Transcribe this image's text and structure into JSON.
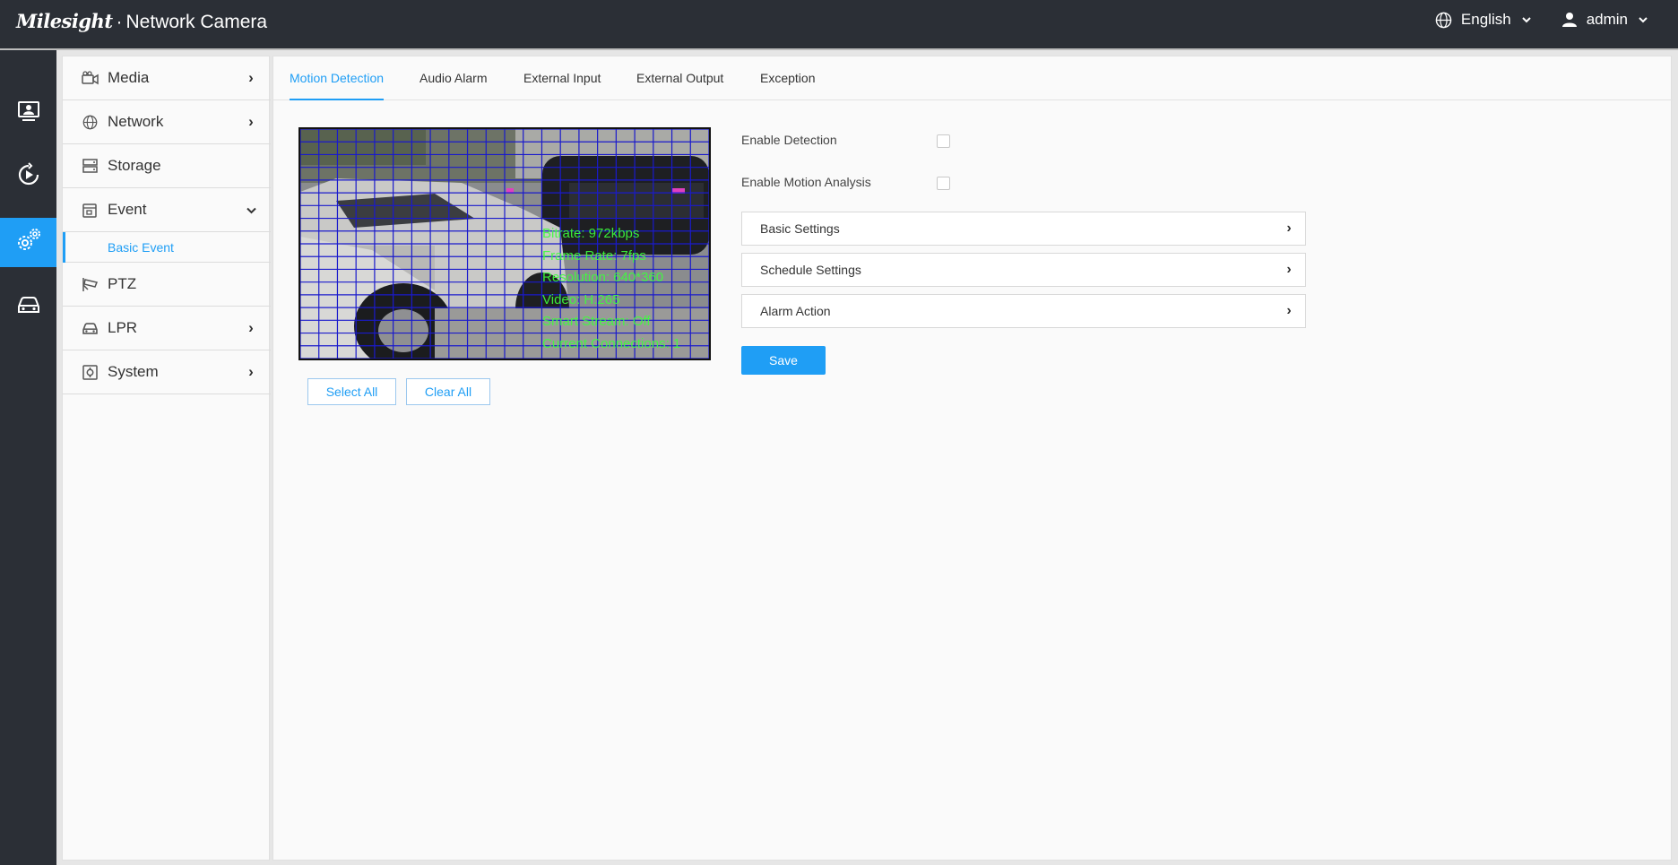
{
  "header": {
    "brand_logo": "Milesight",
    "brand_separator": "·",
    "brand_product": "Network Camera",
    "language": {
      "label": "English",
      "icon": "globe-icon"
    },
    "user": {
      "label": "admin",
      "icon": "user-icon"
    },
    "colors": {
      "bar": "#2b2f36",
      "accent": "#1f9ef5"
    }
  },
  "rail": {
    "items": [
      {
        "name": "live-view",
        "icon": "monitor-user-icon"
      },
      {
        "name": "playback",
        "icon": "play-circle-icon"
      },
      {
        "name": "settings",
        "icon": "gears-icon",
        "active": true
      },
      {
        "name": "vehicle",
        "icon": "car-icon"
      }
    ]
  },
  "subnav": {
    "items": [
      {
        "label": "Media",
        "icon": "camera-icon",
        "chevron": "›"
      },
      {
        "label": "Network",
        "icon": "globe-icon",
        "chevron": "›"
      },
      {
        "label": "Storage",
        "icon": "storage-icon",
        "chevron": ""
      },
      {
        "label": "Event",
        "icon": "event-icon",
        "chevron": "⌄"
      },
      {
        "label": "PTZ",
        "icon": "ptz-camera-icon",
        "chevron": ""
      },
      {
        "label": "LPR",
        "icon": "car-icon",
        "chevron": "›"
      },
      {
        "label": "System",
        "icon": "system-icon",
        "chevron": "›"
      }
    ],
    "active_sub": "Basic Event"
  },
  "tabs": [
    {
      "label": "Motion Detection",
      "active": true
    },
    {
      "label": "Audio Alarm"
    },
    {
      "label": "External Input"
    },
    {
      "label": "External Output"
    },
    {
      "label": "Exception"
    }
  ],
  "preview": {
    "osd": [
      "Bitrate: 972kbps",
      "Frame Rate: 7fps",
      "Resolution: 640*360",
      "Video: H.265",
      "Smart Stream: Off",
      "Current Connections: 1"
    ]
  },
  "buttons": {
    "select_all": "Select All",
    "clear_all": "Clear All",
    "save": "Save"
  },
  "settings": {
    "enable_detection": {
      "label": "Enable Detection",
      "checked": false
    },
    "enable_motion_analysis": {
      "label": "Enable Motion Analysis",
      "checked": false
    },
    "sections": [
      {
        "label": "Basic Settings",
        "arrow": "›"
      },
      {
        "label": "Schedule Settings",
        "arrow": "›"
      },
      {
        "label": "Alarm Action",
        "arrow": "›"
      }
    ]
  }
}
